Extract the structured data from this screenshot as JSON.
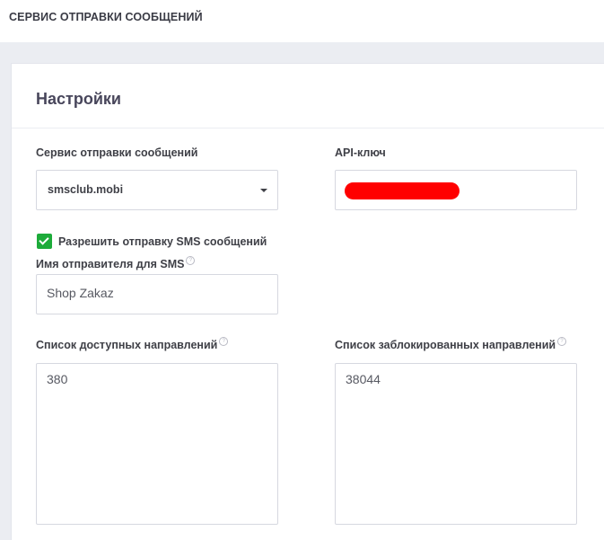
{
  "header": {
    "title": "СЕРВИС ОТПРАВКИ СООБЩЕНИЙ"
  },
  "settings": {
    "title": "Настройки",
    "service": {
      "label": "Сервис отправки сообщений",
      "value": "smsclub.mobi"
    },
    "api_key": {
      "label": "API-ключ"
    },
    "allow_sms": {
      "label": "Разрешить отправку SMS сообщений",
      "checked": true
    },
    "sender_name": {
      "label": "Имя отправителя для SMS",
      "value": "Shop Zakaz"
    },
    "allowed_directions": {
      "label": "Список доступных направлений",
      "value": "380"
    },
    "blocked_directions": {
      "label": "Список заблокированных направлений",
      "value": "38044"
    },
    "help_icon": "?"
  },
  "colors": {
    "check_green": "#1dab3a",
    "redaction": "#ff0000"
  }
}
